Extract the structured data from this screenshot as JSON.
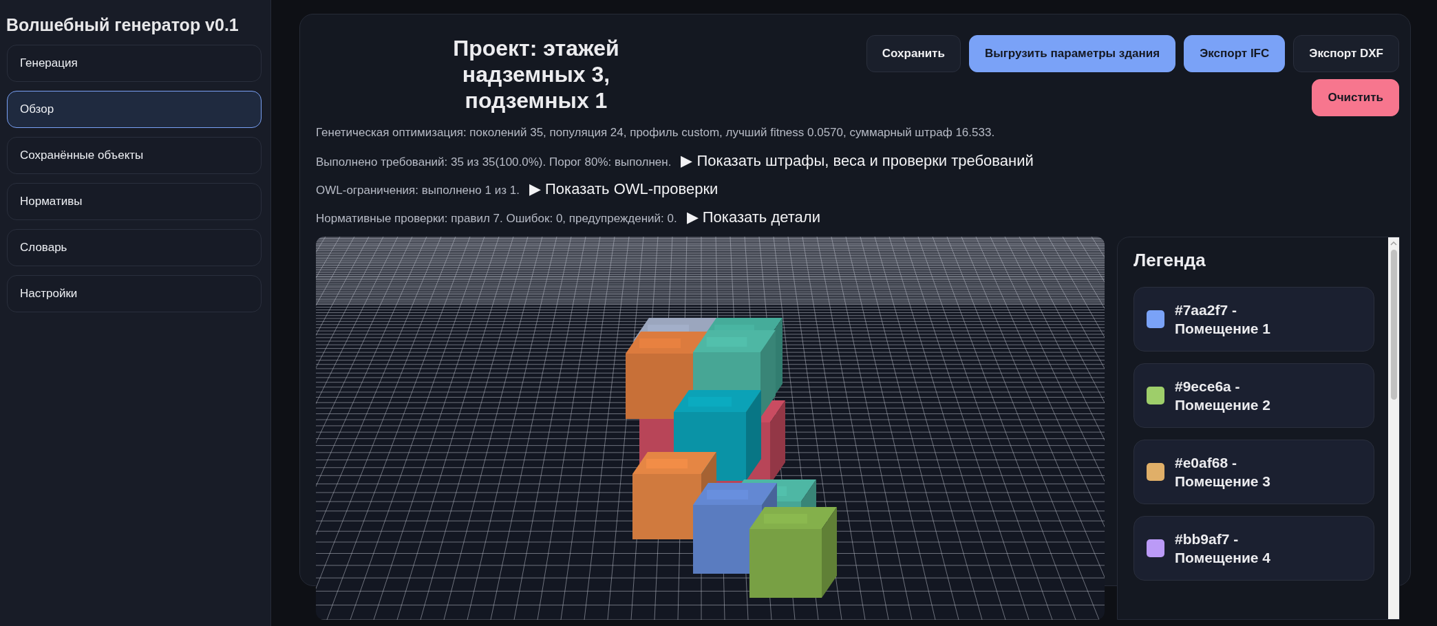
{
  "sidebar": {
    "title": "Волшебный генератор v0.1",
    "items": [
      {
        "label": "Генерация",
        "selected": false
      },
      {
        "label": "Обзор",
        "selected": true
      },
      {
        "label": "Сохранённые объекты",
        "selected": false
      },
      {
        "label": "Нормативы",
        "selected": false
      },
      {
        "label": "Словарь",
        "selected": false
      },
      {
        "label": "Настройки",
        "selected": false
      }
    ]
  },
  "project": {
    "title": "Проект: этажей надземных 3, подземных 1",
    "buttons": [
      {
        "label": "Сохранить",
        "kind": "secondary"
      },
      {
        "label": "Выгрузить параметры здания",
        "kind": "primary"
      },
      {
        "label": "Экспорт IFC",
        "kind": "primary"
      },
      {
        "label": "Экспорт DXF",
        "kind": "secondary"
      },
      {
        "label": "Очистить",
        "kind": "danger"
      }
    ],
    "summary": "Генетическая оптимизация: поколений 35, популяция 24, профиль custom, лучший fitness 0.0570, суммарный штраф 16.533.",
    "checks": [
      {
        "text": "Выполнено требований: 35 из 35(100.0%). Порог 80%: выполнен.",
        "toggle": "▶ Показать штрафы, веса и проверки требований"
      },
      {
        "text": "OWL-ограничения: выполнено 1 из 1.",
        "toggle": "▶ Показать OWL-проверки"
      },
      {
        "text": "Нормативные проверки: правил 7. Ошибок: 0, предупреждений: 0.",
        "toggle": "▶ Показать детали"
      }
    ]
  },
  "legend": {
    "title": "Легенда",
    "items": [
      {
        "label": "#7aa2f7 - Помещение 1",
        "color": "#7aa2f7"
      },
      {
        "label": "#9ece6a - Помещение 2",
        "color": "#9ece6a"
      },
      {
        "label": "#e0af68 - Помещение 3",
        "color": "#e0af68"
      },
      {
        "label": "#bb9af7 - Помещение 4",
        "color": "#bb9af7"
      }
    ]
  }
}
